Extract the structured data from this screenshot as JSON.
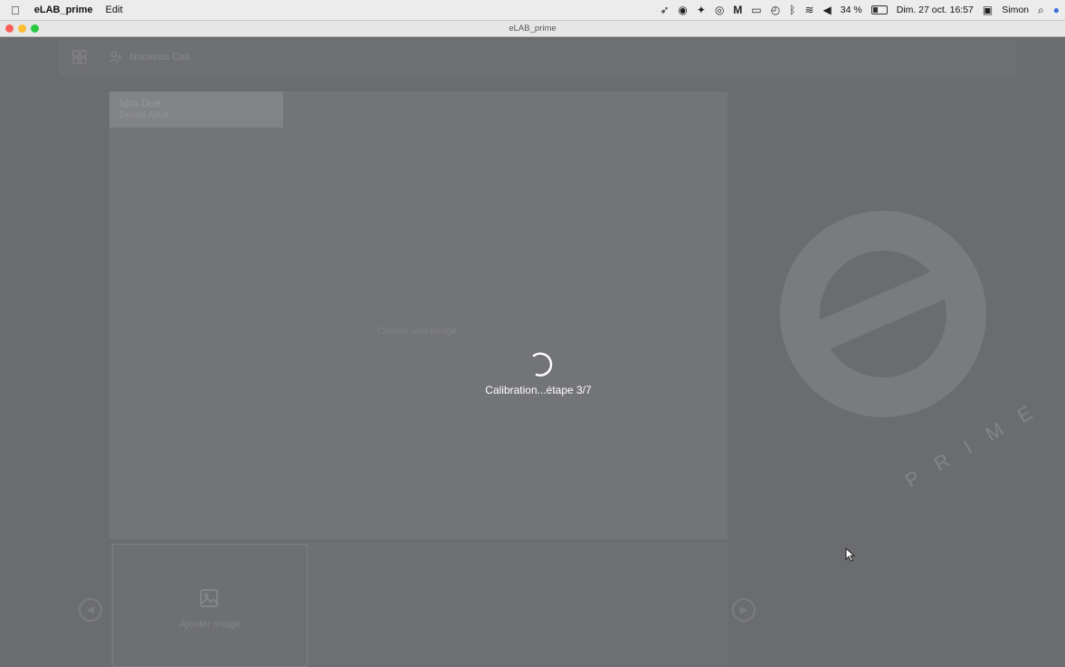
{
  "menubar": {
    "app_name": "eLAB_prime",
    "menus": [
      "Edit"
    ],
    "battery": "34 %",
    "datetime": "Dim. 27 oct. 16:57",
    "user": "Simon"
  },
  "window": {
    "title": "eLAB_prime"
  },
  "toolbar": {
    "new_patient_label": "Nouveau Cas"
  },
  "patient": {
    "name": "Idra Doe",
    "subtitle": "Dental Adult"
  },
  "viewer": {
    "placeholder": "Choisir une image"
  },
  "thumbnails": {
    "add_label": "Ajouter image"
  },
  "loading": {
    "text": "Calibration...étape 3/7"
  },
  "logo": {
    "letters": "PRIME"
  },
  "colors": {
    "background": "#6c6d70",
    "panel": "#737477",
    "spinner": "#ffffff",
    "traffic_red": "#fd5f57",
    "traffic_yellow": "#febc2e",
    "traffic_green": "#28c840"
  },
  "icons": {
    "apple": "apple-icon",
    "toolbar_grid": "grid-icon",
    "toolbar_user": "add-user-icon",
    "add_image": "image-icon",
    "spinner": "spinner-icon"
  }
}
